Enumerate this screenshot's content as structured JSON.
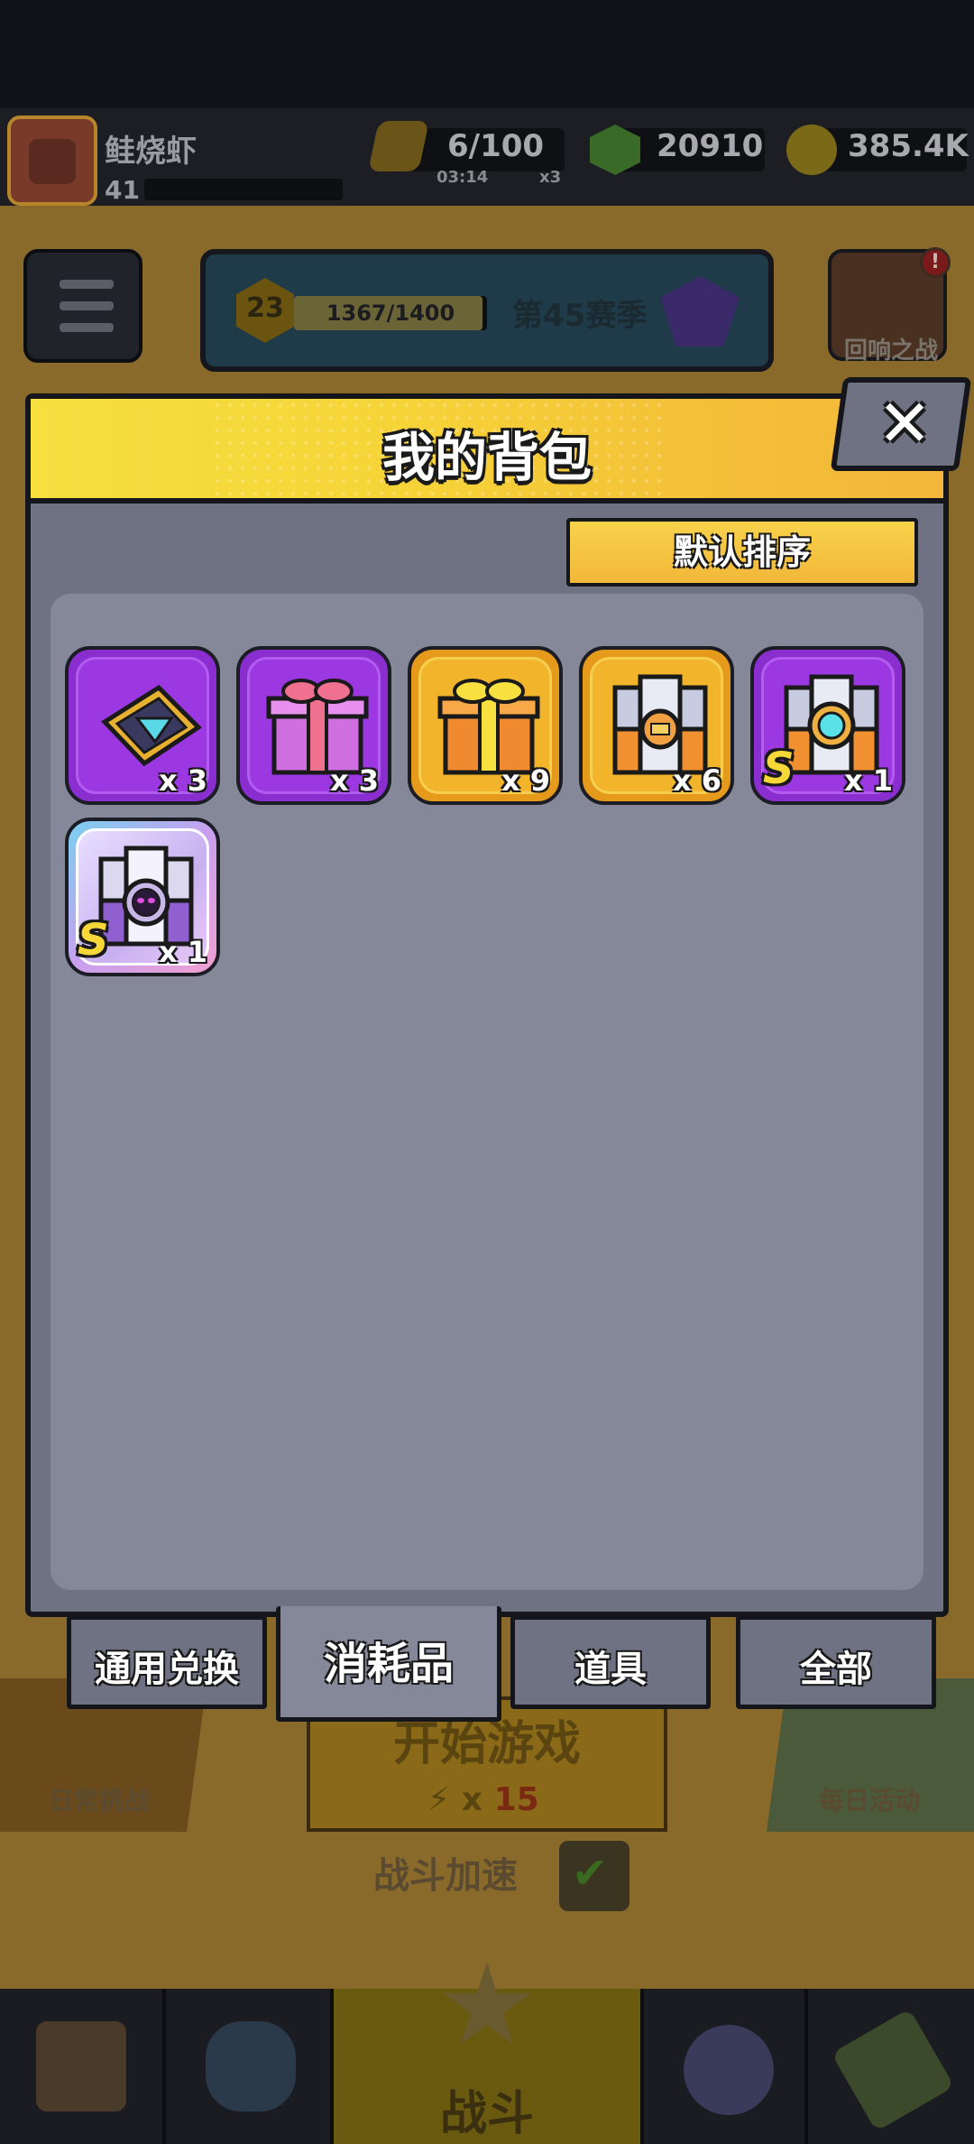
{
  "player": {
    "name": "鲑烧虾",
    "level": "41"
  },
  "resources": {
    "energy": {
      "value": "6/100",
      "timer": "03:14",
      "multiplier": "x3"
    },
    "gems": {
      "value": "20910"
    },
    "coins": {
      "value": "385.4K"
    }
  },
  "season": {
    "level": "23",
    "progress": "1367/1400",
    "progress_fraction": 0.976,
    "name": "第45赛季"
  },
  "echo_battle": {
    "label": "回响之战",
    "badge": "!"
  },
  "background": {
    "daily_challenge": "日常挑战",
    "daily_activity": "每日活动",
    "start_game": "开始游戏",
    "start_cost_prefix": "x",
    "start_cost": "15",
    "battle_speed": "战斗加速",
    "battle": "战斗"
  },
  "modal": {
    "title": "我的背包",
    "close_glyph": "✕",
    "sort_label": "默认排序",
    "items": [
      {
        "icon": "diamond-scroll-icon",
        "quantity": "x 3",
        "rarity": "purple",
        "s_badge": ""
      },
      {
        "icon": "pink-gift-box-icon",
        "quantity": "x 3",
        "rarity": "purple",
        "s_badge": ""
      },
      {
        "icon": "orange-gift-box-icon",
        "quantity": "x 9",
        "rarity": "gold",
        "s_badge": ""
      },
      {
        "icon": "orange-chest-icon",
        "quantity": "x 6",
        "rarity": "gold",
        "s_badge": ""
      },
      {
        "icon": "cyan-gem-chest-icon",
        "quantity": "x 1",
        "rarity": "purple",
        "s_badge": "S"
      },
      {
        "icon": "shadow-chest-icon",
        "quantity": "x 1",
        "rarity": "rainbow",
        "s_badge": "S"
      }
    ],
    "tabs": [
      {
        "label": "通用兑换",
        "active": false
      },
      {
        "label": "消耗品",
        "active": true
      },
      {
        "label": "道具",
        "active": false
      },
      {
        "label": "全部",
        "active": false
      }
    ]
  },
  "colors": {
    "header_yellow": "#f5e040",
    "panel_gray": "#6e7283",
    "inner_gray": "#848899",
    "rarity_purple": "#9b38e2",
    "rarity_gold": "#f2b42a"
  }
}
